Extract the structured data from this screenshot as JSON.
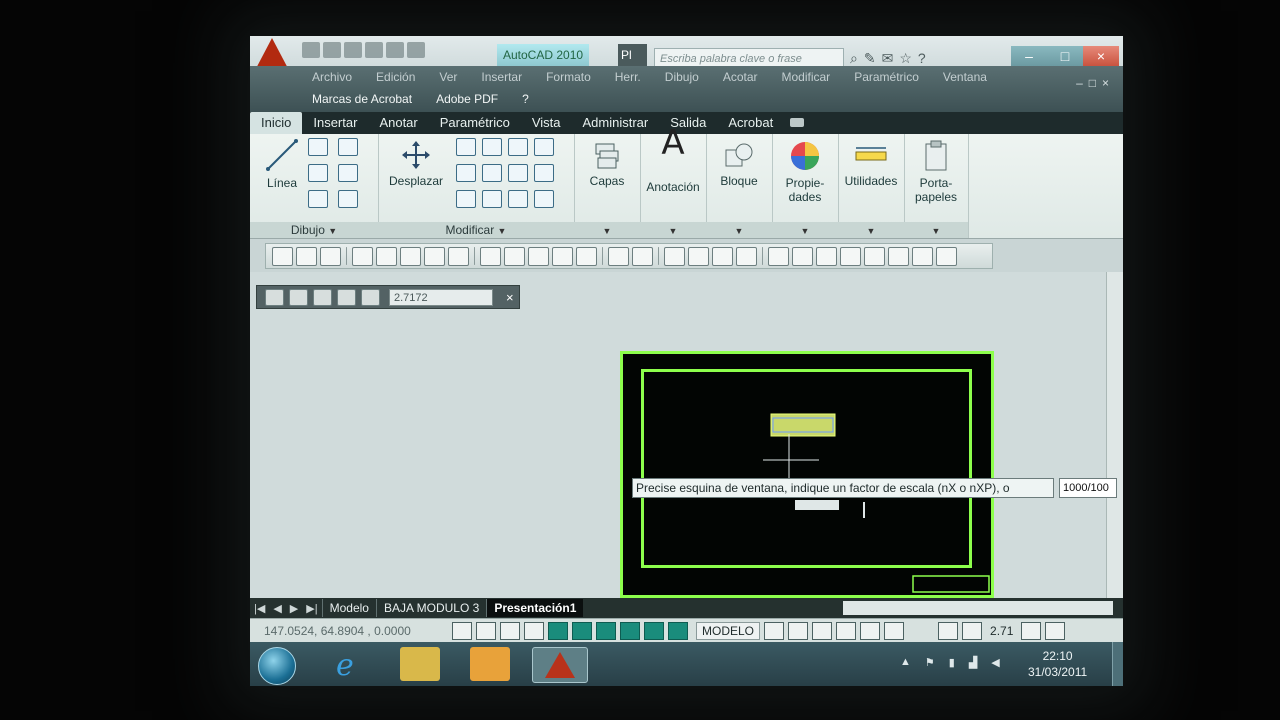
{
  "window": {
    "title": "AutoCAD 2010",
    "title_suffix": "Pl",
    "search_placeholder": "Escriba palabra clave o frase"
  },
  "menu": {
    "row1": [
      "Archivo",
      "Edición",
      "Ver",
      "Insertar",
      "Formato",
      "Herr.",
      "Dibujo",
      "Acotar",
      "Modificar",
      "Paramétrico",
      "Ventana"
    ],
    "row2": [
      "Marcas de Acrobat",
      "Adobe PDF",
      "?"
    ]
  },
  "ribbon_tabs": [
    "Inicio",
    "Insertar",
    "Anotar",
    "Paramétrico",
    "Vista",
    "Administrar",
    "Salida",
    "Acrobat"
  ],
  "ribbon": {
    "linea": "Línea",
    "desplazar": "Desplazar",
    "dibujo_panel": "Dibujo",
    "modificar_panel": "Modificar",
    "capas": "Capas",
    "anotacion": "Anotación",
    "anotacion_glyph": "A",
    "bloque": "Bloque",
    "propiedades_1": "Propie-",
    "propiedades_2": "dades",
    "utilidades": "Utilidades",
    "portapapeles_1": "Porta-",
    "portapapeles_2": "papeles"
  },
  "viewport_toolbar": {
    "scale_value": "2.7172",
    "close": "×"
  },
  "command": {
    "prompt": "Precise esquina de ventana, indique un factor de escala (nX o nXP), o",
    "input": "1000/100"
  },
  "layout_tabs": [
    "Modelo",
    "BAJA MODULO 3",
    "Presentación1"
  ],
  "status": {
    "coords": "147.0524, 64.8904 , 0.0000",
    "space": "MODELO",
    "scale": "2.71"
  },
  "taskbar": {
    "time": "22:10",
    "date": "31/03/2011"
  },
  "colors": {
    "drawing_border": "#8dff4c",
    "sheet_bg": "#020503",
    "accent": "#b22a10"
  }
}
